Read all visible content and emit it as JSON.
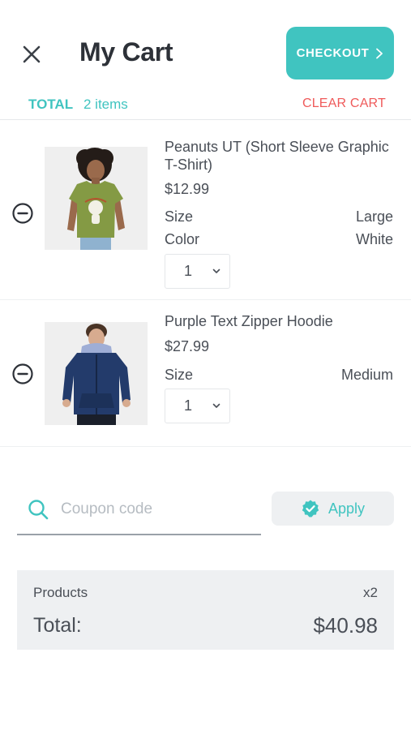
{
  "header": {
    "title": "My Cart",
    "checkout_label": "CHECKOUT",
    "total_label": "TOTAL",
    "items_count": "2 items",
    "clear_cart_label": "CLEAR CART",
    "close_icon": "close-icon",
    "checkout_icon": "chevron-right-icon"
  },
  "cart": {
    "items": [
      {
        "name": "Peanuts UT (Short Sleeve Graphic T-Shirt)",
        "price": "$12.99",
        "attributes": [
          {
            "label": "Size",
            "value": "Large"
          },
          {
            "label": "Color",
            "value": "White"
          }
        ],
        "quantity": "1",
        "image": "olive-green-tshirt-photo"
      },
      {
        "name": "Purple Text Zipper Hoodie",
        "price": "$27.99",
        "attributes": [
          {
            "label": "Size",
            "value": "Medium"
          }
        ],
        "quantity": "1",
        "image": "navy-hoodie-photo"
      }
    ],
    "remove_icon": "minus-circle-icon",
    "dropdown_icon": "chevron-down-icon"
  },
  "coupon": {
    "placeholder": "Coupon code",
    "value": "",
    "apply_label": "Apply",
    "search_icon": "search-icon",
    "apply_icon": "verified-badge-icon"
  },
  "summary": {
    "products_label": "Products",
    "products_count": "x2",
    "total_label": "Total:",
    "total_amount": "$40.98"
  },
  "colors": {
    "accent": "#40c4c0",
    "danger": "#ef5a5a",
    "text": "#4a4f57",
    "title": "#2d3138",
    "panel": "#eef0f2"
  }
}
